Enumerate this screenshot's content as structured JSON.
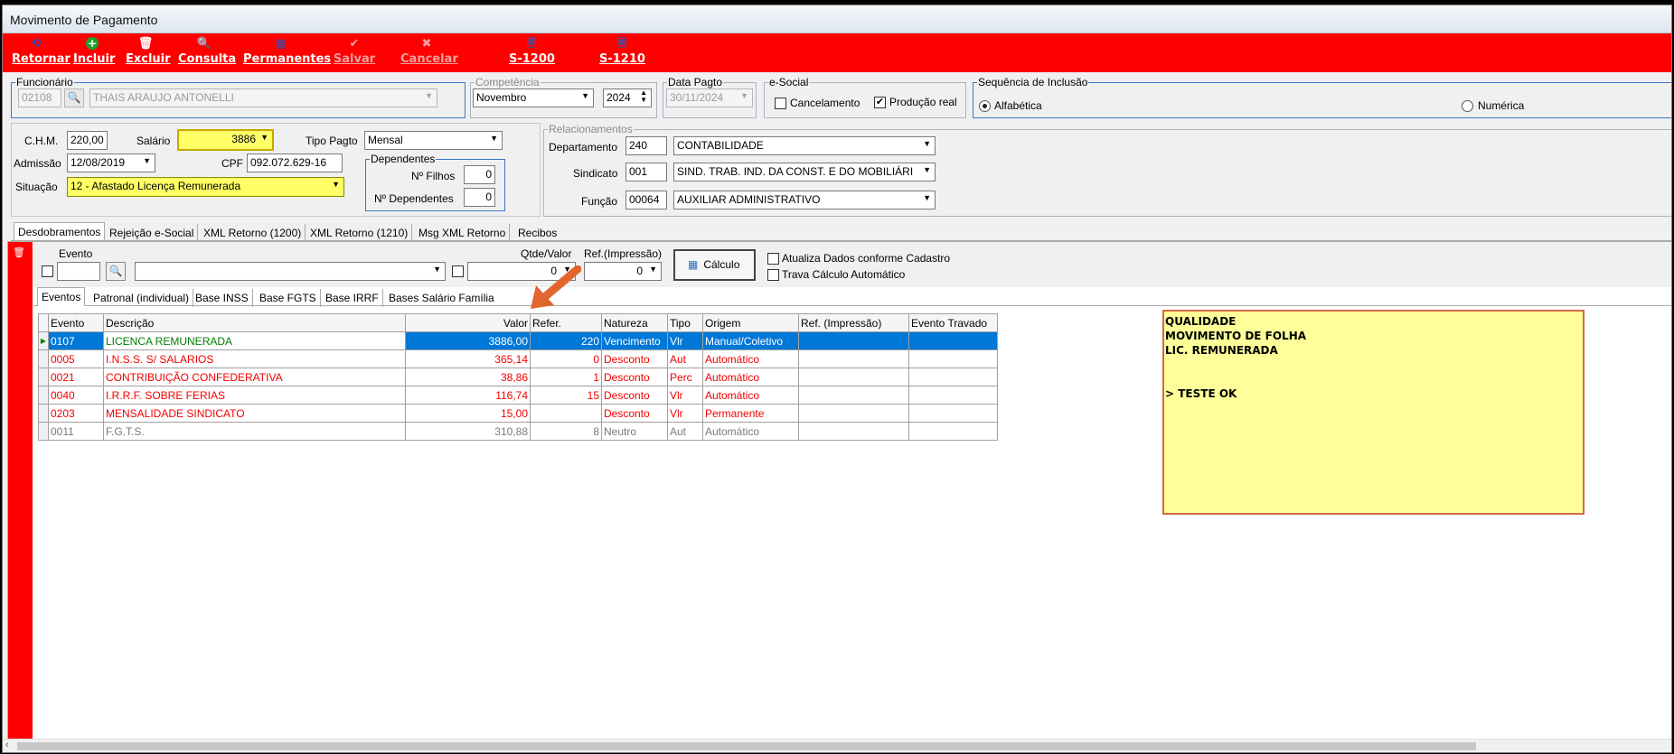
{
  "window": {
    "title": "Movimento de Pagamento"
  },
  "toolbar": {
    "retornar": "Retornar",
    "incluir": "Incluir",
    "excluir": "Excluir",
    "consulta": "Consulta",
    "permanentes": "Permanentes",
    "salvar": "Salvar",
    "cancelar": "Cancelar",
    "s1200": "S-1200",
    "s1210": "S-1210"
  },
  "funcionario": {
    "legend": "Funcionário",
    "code": "02108",
    "name": "THAIS ARAUJO ANTONELLI"
  },
  "competencia": {
    "legend": "Competência",
    "month": "Novembro",
    "year": "2024"
  },
  "data_pagto": {
    "legend": "Data Pagto",
    "value": "30/11/2024"
  },
  "esocial": {
    "legend": "e-Social",
    "cancelamento": "Cancelamento",
    "producao": "Produção real",
    "producao_checked": true
  },
  "sequencia": {
    "legend": "Sequência de Inclusão",
    "alfabetica": "Alfabética",
    "numerica": "Numérica",
    "selected": "Alfabética"
  },
  "dados": {
    "chm_label": "C.H.M.",
    "chm": "220,00",
    "salario_label": "Salário",
    "salario": "3886",
    "tipo_pagto_label": "Tipo Pagto",
    "tipo_pagto": "Mensal",
    "admissao_label": "Admissão",
    "admissao": "12/08/2019",
    "cpf_label": "CPF",
    "cpf": "092.072.629-16",
    "situacao_label": "Situação",
    "situacao": "12 - Afastado Licença Remunerada"
  },
  "dependentes": {
    "legend": "Dependentes",
    "filhos_label": "Nº Filhos",
    "filhos": "0",
    "dep_label": "Nº Dependentes",
    "dep": "0"
  },
  "relacionamentos": {
    "legend": "Relacionamentos",
    "departamento_label": "Departamento",
    "departamento_code": "240",
    "departamento": "CONTABILIDADE",
    "sindicato_label": "Sindicato",
    "sindicato_code": "001",
    "sindicato": "SIND. TRAB. IND. DA CONST. E DO MOBILIÁRI",
    "funcao_label": "Função",
    "funcao_code": "00064",
    "funcao": "AUXILIAR ADMINISTRATIVO"
  },
  "main_tabs": [
    "Desdobramentos",
    "Rejeição e-Social",
    "XML Retorno (1200)",
    "XML Retorno (1210)",
    "Msg XML Retorno",
    "Recibos"
  ],
  "evento_bar": {
    "evento_label": "Evento",
    "qtde_label": "Qtde/Valor",
    "qtde_value": "0",
    "ref_label": "Ref.(Impressão)",
    "ref_value": "0",
    "calculo": "Cálculo",
    "atualiza": "Atualiza Dados conforme Cadastro",
    "trava": "Trava Cálculo Automático"
  },
  "sub_tabs": [
    "Eventos",
    "Patronal (individual)",
    "Base INSS",
    "Base FGTS",
    "Base IRRF",
    "Bases Salário Família"
  ],
  "grid": {
    "headers": [
      "Evento",
      "Descrição",
      "Valor",
      "Refer.",
      "Natureza",
      "Tipo",
      "Origem",
      "Ref. (Impressão)",
      "Evento Travado"
    ],
    "rows": [
      [
        "0107",
        "LICENCA REMUNERADA",
        "3886,00",
        "220",
        "Vencimento",
        "Vlr",
        "Manual/Coletivo",
        "",
        ""
      ],
      [
        "0005",
        "I.N.S.S. S/ SALARIOS",
        "365,14",
        "0",
        "Desconto",
        "Aut",
        "Automático",
        "",
        ""
      ],
      [
        "0021",
        "CONTRIBUIÇÃO CONFEDERATIVA",
        "38,86",
        "1",
        "Desconto",
        "Perc",
        "Automático",
        "",
        ""
      ],
      [
        "0040",
        "I.R.R.F. SOBRE FERIAS",
        "116,74",
        "15",
        "Desconto",
        "Vlr",
        "Automático",
        "",
        ""
      ],
      [
        "0203",
        "MENSALIDADE SINDICATO",
        "15,00",
        "",
        "Desconto",
        "Vlr",
        "Permanente",
        "",
        ""
      ],
      [
        "0011",
        "F.G.T.S.",
        "310,88",
        "8",
        "Neutro",
        "Aut",
        "Automático",
        "",
        ""
      ]
    ]
  },
  "note": {
    "lines": [
      "QUALIDADE",
      "MOVIMENTO DE FOLHA",
      "LIC. REMUNERADA",
      "",
      "",
      "> TESTE OK"
    ]
  },
  "colors": {
    "toolbar": "#fe0000",
    "highlight": "#ffff66",
    "selection": "#0078d7",
    "note": "#ffff99",
    "arrow": "#e2652f"
  }
}
